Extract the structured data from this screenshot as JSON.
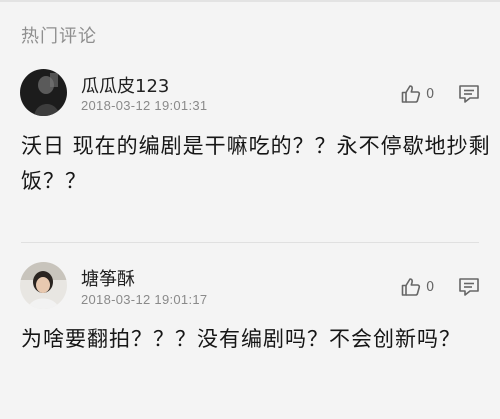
{
  "section": {
    "title": "热门评论"
  },
  "comments": [
    {
      "username": "瓜瓜皮123",
      "timestamp": "2018-03-12 19:01:31",
      "likes": "0",
      "content": "沃日 现在的编剧是干嘛吃的？？永不停歇地抄剩饭？？",
      "avatar_icon": "dark-photo-avatar"
    },
    {
      "username": "塘筝酥",
      "timestamp": "2018-03-12 19:01:17",
      "likes": "0",
      "content": "为啥要翻拍？？？没有编剧吗？不会创新吗？",
      "avatar_icon": "person-photo-avatar"
    }
  ],
  "colors": {
    "background": "#f4f4f4",
    "text": "#161616",
    "meta": "#8a8a8a",
    "icon": "#666666"
  }
}
